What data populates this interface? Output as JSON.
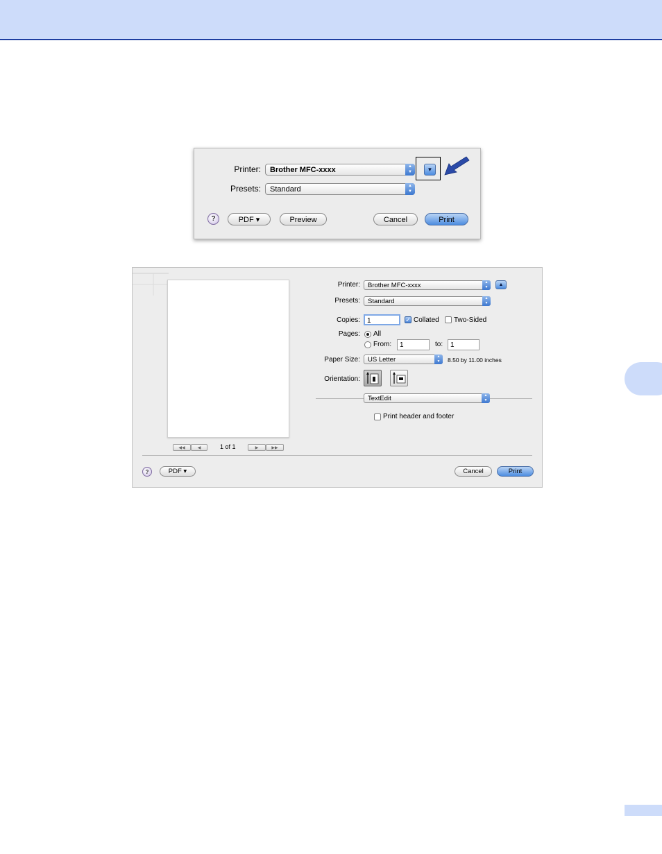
{
  "dialog_collapsed": {
    "printer_label": "Printer:",
    "printer_value": "Brother MFC-xxxx",
    "presets_label": "Presets:",
    "presets_value": "Standard",
    "help_label": "?",
    "pdf_label": "PDF ▾",
    "preview_label": "Preview",
    "cancel_label": "Cancel",
    "print_label": "Print",
    "disclosure_glyph": "▼"
  },
  "dialog_expanded": {
    "printer_label": "Printer:",
    "printer_value": "Brother MFC-xxxx",
    "disclosure_glyph": "▲",
    "presets_label": "Presets:",
    "presets_value": "Standard",
    "copies_label": "Copies:",
    "copies_value": "1",
    "collated_label": "Collated",
    "collated_checked": true,
    "two_sided_label": "Two-Sided",
    "two_sided_checked": false,
    "pages_label": "Pages:",
    "all_label": "All",
    "from_label": "From:",
    "from_value": "1",
    "to_label": "to:",
    "to_value": "1",
    "paper_size_label": "Paper Size:",
    "paper_size_value": "US Letter",
    "paper_size_dims": "8.50 by 11.00 inches",
    "orientation_label": "Orientation:",
    "panel_value": "TextEdit",
    "header_footer_label": "Print header and footer",
    "header_footer_checked": false,
    "page_indicator": "1 of 1",
    "nav_first": "◀◀",
    "nav_prev": "◀",
    "nav_next": "▶",
    "nav_last": "▶▶",
    "help_label": "?",
    "pdf_label": "PDF ▾",
    "cancel_label": "Cancel",
    "print_label": "Print"
  },
  "colors": {
    "header_band": "#cddcfa",
    "header_rule": "#1e3ea0",
    "arrow": "#2b4aa8",
    "aqua_blue": "#4d8de0"
  }
}
